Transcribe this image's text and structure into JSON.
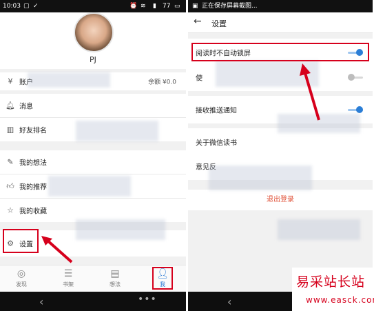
{
  "left": {
    "status": {
      "time": "10:03",
      "battery": "77"
    },
    "profile": {
      "name": "PJ"
    },
    "account": {
      "label": "账户",
      "balance": "余额 ¥0.0"
    },
    "menu": [
      {
        "label": "消息",
        "icon": "bell-icon"
      },
      {
        "label": "好友排名",
        "icon": "bar-chart-icon"
      },
      {
        "label": "我的想法",
        "icon": "feather-icon"
      },
      {
        "label": "我的推荐",
        "icon": "thumbs-up-icon"
      },
      {
        "label": "我的收藏",
        "icon": "star-icon"
      },
      {
        "label": "设置",
        "icon": "gear-icon"
      }
    ],
    "tabs": [
      {
        "label": "发现",
        "icon": "compass-icon"
      },
      {
        "label": "书架",
        "icon": "bookshelf-icon"
      },
      {
        "label": "想法",
        "icon": "chat-icon"
      },
      {
        "label": "我",
        "icon": "person-icon"
      }
    ]
  },
  "right": {
    "status": {
      "notice": "正在保存屏幕截图..."
    },
    "title": "设置",
    "settings": [
      {
        "label": "阅读时不自动锁屏",
        "toggle": true
      },
      {
        "label": "使",
        "toggle": false
      },
      {
        "label": "接收推送通知",
        "toggle": true
      },
      {
        "label": "关于微信读书"
      },
      {
        "label": "意见反"
      }
    ],
    "logout": "退出登录"
  },
  "watermark": {
    "title": "易采站长站",
    "url": "www.easck.com"
  },
  "colors": {
    "accent": "#2b7ed6",
    "highlight": "#d6001c",
    "logout": "#e0533a"
  }
}
